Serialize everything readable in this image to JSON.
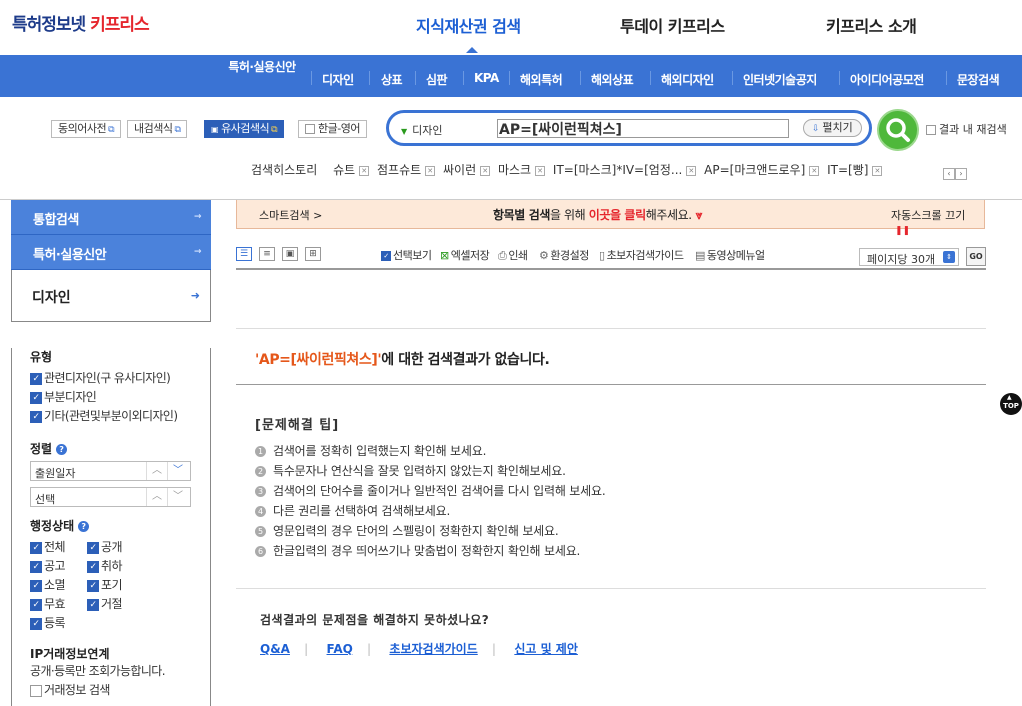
{
  "header": {
    "logo_main": "특허정보넷 ",
    "logo_accent": "키프리스",
    "tabs": [
      "지식재산권 검색",
      "투데이 키프리스",
      "키프리스 소개"
    ]
  },
  "nav": {
    "items": [
      "특허·실용신안",
      "디자인",
      "상표",
      "심판",
      "KPA",
      "해외특허",
      "해외상표",
      "해외디자인",
      "인터넷기술공지",
      "아이디어공모전",
      "문장검색"
    ]
  },
  "tools": {
    "btn1": "동의어사전",
    "btn2": "내검색식",
    "btn3": "유사검색식",
    "btn4": "한글-영어"
  },
  "search": {
    "category": "디자인",
    "query": "AP=[싸이런픽쳐스]",
    "expand": "펼치기",
    "within_results": "결과 내 재검색"
  },
  "history": {
    "label": "검색히스토리",
    "items": [
      "슈트",
      "점프슈트",
      "싸이런",
      "마스크",
      "IT=[마스크]*IV=[엄정...",
      "AP=[마크앤드로우]",
      "IT=[빵]"
    ]
  },
  "sidebar": {
    "items": [
      "통합검색",
      "특허·실용신안"
    ],
    "active": "디자인",
    "type_title": "유형",
    "types": [
      "관련디자인(구 유사디자인)",
      "부분디자인",
      "기타(관련및부분이외디자인)"
    ],
    "sort_title": "정렬",
    "sort1": "출원일자",
    "sort2": "선택",
    "status_title": "행정상태",
    "statuses": [
      "전체",
      "공개",
      "공고",
      "취하",
      "소멸",
      "포기",
      "무효",
      "거절",
      "등록"
    ],
    "ip_title": "IP거래정보연계",
    "ip_desc": "공개·등록만 조회가능합니다.",
    "ip_check": "거래정보 검색"
  },
  "smart": {
    "left": "스마트검색 >",
    "center_a": "항목별 검색",
    "center_b": "을 위해 ",
    "center_c": "이곳을 클릭",
    "center_d": "해주세요.",
    "right": "자동스크롤 끄기"
  },
  "viewbar": {
    "tools": [
      "선택보기",
      "엑셀저장",
      "인쇄",
      "환경설정",
      "초보자검색가이드",
      "동영상메뉴얼"
    ],
    "per_page": "페이지당 30개",
    "go": "GO"
  },
  "noresult": {
    "keyword": "'AP=[싸이런픽쳐스]'",
    "suffix": "에 대한 검색결과가 없습니다."
  },
  "tips": {
    "title": "[문제해결 팁]",
    "items": [
      "검색어를 정확히 입력했는지 확인해 보세요.",
      "특수문자나 연산식을 잘못 입력하지 않았는지 확인해보세요.",
      "검색어의 단어수를 줄이거나 일반적인 검색어를 다시 입력해 보세요.",
      "다른 권리를 선택하여 검색해보세요.",
      "영문입력의 경우 단어의 스펠링이 정확한지 확인해 보세요.",
      "한글입력의 경우 띄어쓰기나 맞춤법이 정확한지 확인해 보세요."
    ]
  },
  "help": {
    "question": "검색결과의 문제점을 해결하지 못하셨나요?",
    "links": [
      "Q&A",
      "FAQ",
      "초보자검색가이드",
      "신고 및 제안"
    ]
  },
  "top": "TOP"
}
